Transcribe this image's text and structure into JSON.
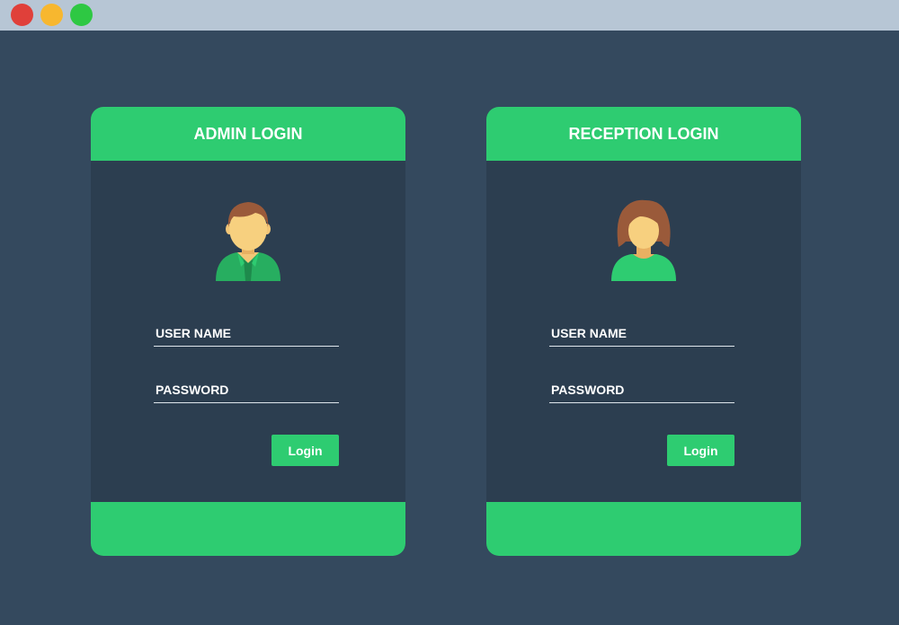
{
  "window": {
    "controls": [
      "close-button",
      "minimize-button",
      "maximize-button"
    ],
    "colors": {
      "close": "#e0403a",
      "minimize": "#f7b72f",
      "maximize": "#2ec843"
    }
  },
  "admin": {
    "title": "ADMIN LOGIN",
    "avatar_icon": "male-user-icon",
    "username_label": "USER NAME",
    "password_label": "PASSWORD",
    "login_label": "Login"
  },
  "reception": {
    "title": "RECEPTION LOGIN",
    "avatar_icon": "female-user-icon",
    "username_label": "USER NAME",
    "password_label": "PASSWORD",
    "login_label": "Login"
  },
  "theme": {
    "accent": "#2ecc71",
    "background": "#34495e",
    "card_body": "#2c3e50"
  }
}
